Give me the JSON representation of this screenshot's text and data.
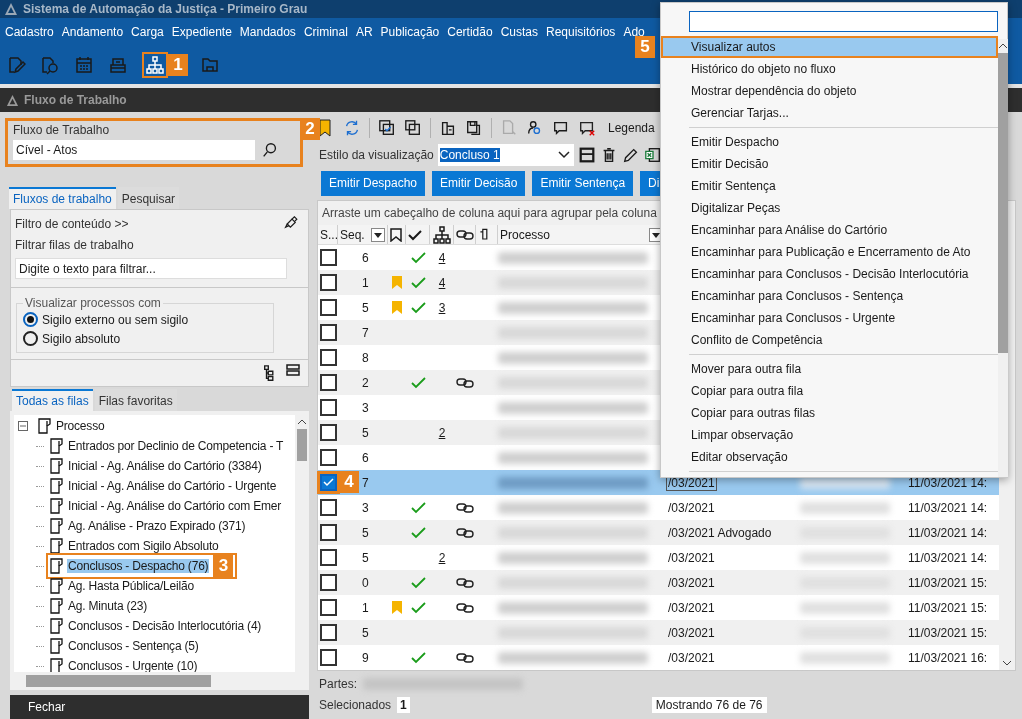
{
  "window": {
    "title": "Sistema de Automação da Justiça - Primeiro Grau"
  },
  "menu_bar": [
    "Cadastro",
    "Andamento",
    "Carga",
    "Expediente",
    "Mandados",
    "Criminal",
    "AR",
    "Publicação",
    "Certidão",
    "Custas",
    "Requisitórios",
    "Ado"
  ],
  "toolbar": {
    "callout": "1"
  },
  "panel_title": "Fluxo de Trabalho",
  "workflow": {
    "label": "Fluxo de Trabalho",
    "value": "Cível - Atos",
    "callout": "2"
  },
  "left_tabs": [
    {
      "label": "Fluxos de trabalho",
      "selected": true
    },
    {
      "label": "Pesquisar",
      "selected": false
    }
  ],
  "content_filter": {
    "title": "Filtro de conteúdo >>",
    "filter_label": "Filtrar filas de trabalho",
    "placeholder": "Digite o texto para filtrar..."
  },
  "visibility": {
    "legend": "Visualizar processos com",
    "options": [
      {
        "label": "Sigilo externo ou sem sigilo",
        "selected": true
      },
      {
        "label": "Sigilo absoluto",
        "selected": false
      }
    ]
  },
  "queue_tabs": [
    {
      "label": "Todas as filas",
      "selected": true
    },
    {
      "label": "Filas favoritas",
      "selected": false
    }
  ],
  "tree": [
    {
      "label": "Processo",
      "expanded": true,
      "selected": false,
      "children": [
        {
          "label": "Entrados por Declinio de Competencia - T",
          "selected": false
        },
        {
          "label": "Inicial - Ag. Análise do Cartório (3384)",
          "selected": false
        },
        {
          "label": "Inicial - Ag. Análise do Cartório - Urgente",
          "selected": false
        },
        {
          "label": "Inicial - Ag. Análise do Cartório com Emer",
          "selected": false
        },
        {
          "label": "Ag. Análise - Prazo Expirado (371)",
          "selected": false
        },
        {
          "label": "Entrados com Sigilo Absoluto",
          "selected": false
        },
        {
          "label": "Conclusos - Despacho (76)",
          "selected": true,
          "callout": "3"
        },
        {
          "label": "Ag. Hasta Pública/Leilão",
          "selected": false
        },
        {
          "label": "Ag. Minuta (23)",
          "selected": false
        },
        {
          "label": "Conclusos - Decisão Interlocutória (4)",
          "selected": false
        },
        {
          "label": "Conclusos - Sentença (5)",
          "selected": false
        },
        {
          "label": "Conclusos - Urgente (10)",
          "selected": false
        }
      ]
    }
  ],
  "close_button": "Fechar",
  "grid_toolbar": {
    "legend": "Legenda"
  },
  "view_style": {
    "label": "Estilo da visualização",
    "value": "Concluso 1"
  },
  "action_buttons": [
    "Emitir Despacho",
    "Emitir Decisão",
    "Emitir Sentença",
    "Di"
  ],
  "group_hint": "Arraste um cabeçalho de coluna aqui para agrupar pela coluna",
  "columns": {
    "select": "S...",
    "seq": "Seq.",
    "process": "Processo"
  },
  "rows": [
    {
      "seq": "6",
      "checked": false,
      "selected": false,
      "bookmarked": false,
      "done": true,
      "count": "4",
      "linked": false
    },
    {
      "seq": "1",
      "checked": false,
      "selected": false,
      "bookmarked": true,
      "done": true,
      "count": "4",
      "linked": false
    },
    {
      "seq": "5",
      "checked": false,
      "selected": false,
      "bookmarked": true,
      "done": true,
      "count": "3",
      "linked": false
    },
    {
      "seq": "7",
      "checked": false,
      "selected": false,
      "bookmarked": false,
      "done": false,
      "linked": false
    },
    {
      "seq": "8",
      "checked": false,
      "selected": false,
      "bookmarked": false,
      "done": false,
      "linked": false
    },
    {
      "seq": "2",
      "checked": false,
      "selected": false,
      "bookmarked": false,
      "done": true,
      "linked": true
    },
    {
      "seq": "3",
      "checked": false,
      "selected": false,
      "bookmarked": false,
      "done": false,
      "linked": false
    },
    {
      "seq": "5",
      "checked": false,
      "selected": false,
      "bookmarked": false,
      "done": false,
      "count": "2",
      "linked": false
    },
    {
      "seq": "6",
      "checked": false,
      "selected": false,
      "bookmarked": false,
      "done": false,
      "linked": false
    },
    {
      "seq": "7",
      "checked": true,
      "selected": true,
      "bookmarked": false,
      "done": false,
      "linked": false,
      "callout": "4",
      "date": "/03/2021",
      "time": "11/03/2021 14:"
    },
    {
      "seq": "3",
      "checked": false,
      "selected": false,
      "bookmarked": false,
      "done": true,
      "linked": true,
      "date": "/03/2021",
      "time": "11/03/2021 14:"
    },
    {
      "seq": "5",
      "checked": false,
      "selected": false,
      "bookmarked": false,
      "done": true,
      "linked": true,
      "date": "/03/2021 Advogado",
      "time": "11/03/2021 14:"
    },
    {
      "seq": "5",
      "checked": false,
      "selected": false,
      "bookmarked": false,
      "done": false,
      "count": "2",
      "linked": false,
      "date": "/03/2021",
      "time": "11/03/2021 14:"
    },
    {
      "seq": "0",
      "checked": false,
      "selected": false,
      "bookmarked": false,
      "done": true,
      "linked": true,
      "date": "/03/2021",
      "time": "11/03/2021 15:"
    },
    {
      "seq": "1",
      "checked": false,
      "selected": false,
      "bookmarked": true,
      "done": true,
      "linked": true,
      "date": "/03/2021",
      "time": "11/03/2021 15:"
    },
    {
      "seq": "5",
      "checked": false,
      "selected": false,
      "bookmarked": false,
      "done": false,
      "linked": false,
      "date": "/03/2021",
      "time": "11/03/2021 15:"
    },
    {
      "seq": "9",
      "checked": false,
      "selected": false,
      "bookmarked": false,
      "done": true,
      "linked": true,
      "date": "/03/2021",
      "time": "11/03/2021 16:"
    }
  ],
  "parts_label": "Partes:",
  "selected_label": "Selecionados",
  "selected_count": "1",
  "showing": "Mostrando 76 de 76",
  "context_menu": {
    "sections": [
      [
        {
          "label": "Visualizar autos",
          "selected": true,
          "callout": "5"
        },
        {
          "label": "Histórico do objeto no fluxo",
          "selected": false
        },
        {
          "label": "Mostrar dependência do objeto",
          "selected": false
        },
        {
          "label": "Gerenciar Tarjas...",
          "selected": false
        }
      ],
      [
        {
          "label": "Emitir Despacho",
          "selected": false
        },
        {
          "label": "Emitir Decisão",
          "selected": false
        },
        {
          "label": "Emitir Sentença",
          "selected": false
        },
        {
          "label": "Digitalizar Peças",
          "selected": false
        },
        {
          "label": "Encaminhar para Análise do Cartório",
          "selected": false
        },
        {
          "label": "Encaminhar para Publicação e Encerramento de Ato",
          "selected": false
        },
        {
          "label": "Encaminhar para Conclusos - Decisão Interlocutória",
          "selected": false
        },
        {
          "label": "Encaminhar para Conclusos - Sentença",
          "selected": false
        },
        {
          "label": "Encaminhar para Conclusos - Urgente",
          "selected": false
        },
        {
          "label": "Conflito de Competência",
          "selected": false
        }
      ],
      [
        {
          "label": "Mover para outra fila",
          "selected": false
        },
        {
          "label": "Copiar para outra fila",
          "selected": false
        },
        {
          "label": "Copiar para outras filas",
          "selected": false
        },
        {
          "label": "Limpar observação",
          "selected": false
        },
        {
          "label": "Editar observação",
          "selected": false
        }
      ]
    ]
  }
}
